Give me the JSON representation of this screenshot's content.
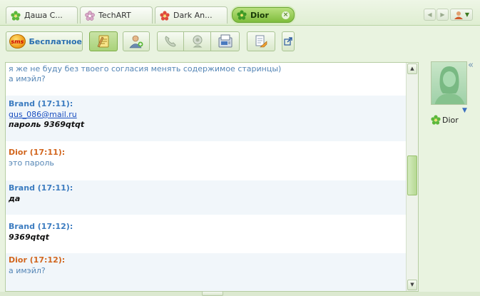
{
  "tabs": [
    {
      "label": "Даша С...",
      "icon": "flower-green-icon"
    },
    {
      "label": "TechART",
      "icon": "flower-pink-icon"
    },
    {
      "label": "Dark An...",
      "icon": "flower-red-icon"
    },
    {
      "label": "Dior",
      "icon": "flower-green-icon",
      "active": true
    }
  ],
  "toolbar": {
    "sms_badge": "sms",
    "sms_label": "Бесплатное"
  },
  "messages": [
    {
      "lines": [
        "я же не буду без твоего согласия менять содержимое старинцы)",
        "а имэйл?"
      ],
      "style": "plain"
    },
    {
      "sender": "Brand (17:11):",
      "who": "brand",
      "link": "gus_086@mail.ru",
      "bold": "пароль 9369qtqt"
    },
    {
      "sender": "Dior (17:11):",
      "who": "dior",
      "lines": [
        "это пароль"
      ],
      "style": "plain"
    },
    {
      "sender": "Brand (17:11):",
      "who": "brand",
      "bold": "да"
    },
    {
      "sender": "Brand (17:12):",
      "who": "brand",
      "bold": "9369qtqt"
    },
    {
      "sender": "Dior (17:12):",
      "who": "dior",
      "lines": [
        "а имэйл?"
      ],
      "style": "plain"
    }
  ],
  "contact": {
    "name": "Dior"
  },
  "colors": {
    "brand": "#3c7cc0",
    "dior": "#d2661e",
    "accent": "#7fbd3c"
  }
}
